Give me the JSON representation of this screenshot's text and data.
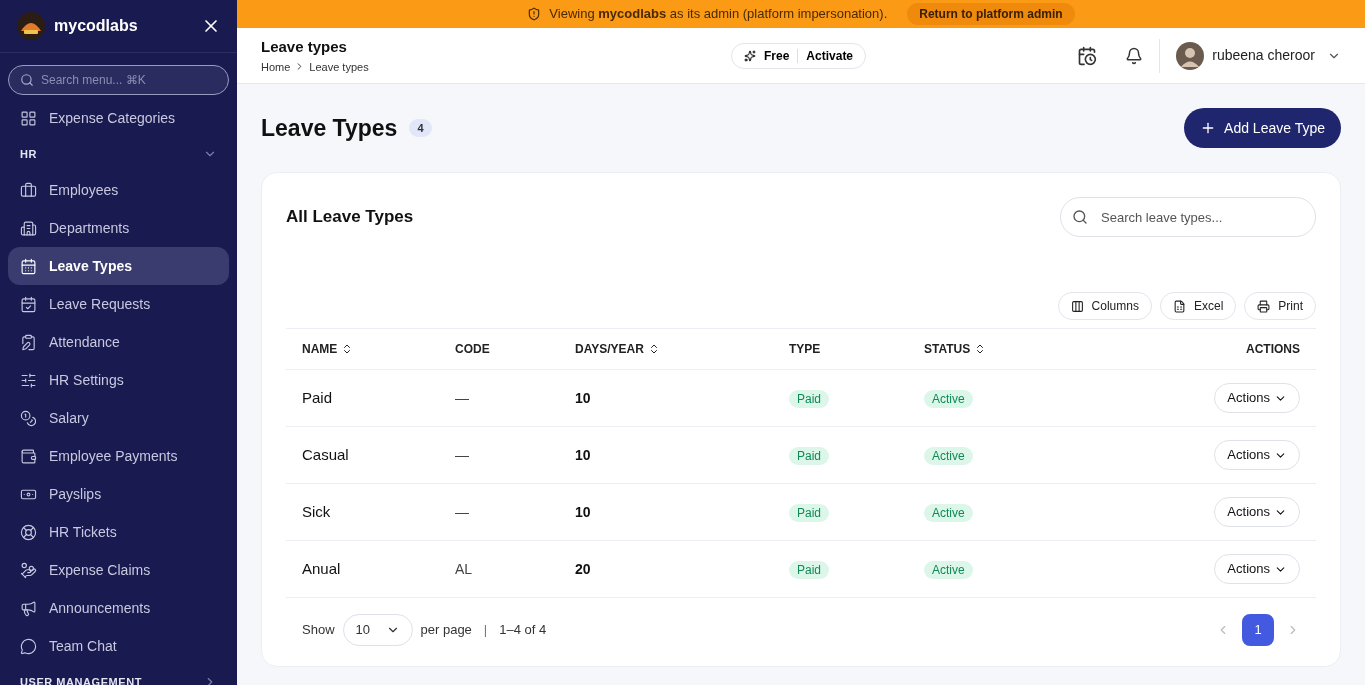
{
  "sidebar": {
    "brand": "mycodlabs",
    "search": {
      "placeholder": "Search menu... ⌘K"
    },
    "items_before": [
      {
        "label": "Expense Categories",
        "selected": false
      }
    ],
    "sections": [
      {
        "title": "HR",
        "expanded": true,
        "items": [
          {
            "label": "Employees",
            "selected": false
          },
          {
            "label": "Departments",
            "selected": false
          },
          {
            "label": "Leave Types",
            "selected": true
          },
          {
            "label": "Leave Requests",
            "selected": false
          },
          {
            "label": "Attendance",
            "selected": false
          },
          {
            "label": "HR Settings",
            "selected": false
          },
          {
            "label": "Salary",
            "selected": false
          },
          {
            "label": "Employee Payments",
            "selected": false
          },
          {
            "label": "Payslips",
            "selected": false
          },
          {
            "label": "HR Tickets",
            "selected": false
          },
          {
            "label": "Expense Claims",
            "selected": false
          },
          {
            "label": "Announcements",
            "selected": false
          },
          {
            "label": "Team Chat",
            "selected": false
          }
        ]
      },
      {
        "title": "USER MANAGEMENT",
        "expanded": false
      }
    ]
  },
  "banner": {
    "text": "Viewing **mycodlabs** as its admin (platform impersonation).",
    "button": "Return to platform admin"
  },
  "header": {
    "title": "Leave types",
    "breadcrumb": [
      "Home",
      "Leave types"
    ],
    "plan": "Free",
    "plan_action": "Activate",
    "user": "rubeena cheroor"
  },
  "page": {
    "title": "Leave Types",
    "count": "4",
    "add_button": "Add Leave Type"
  },
  "table": {
    "title": "All Leave Types",
    "search": {
      "placeholder": "Search leave types..."
    },
    "tools": [
      "Columns",
      "Excel",
      "Print"
    ],
    "columns": [
      {
        "label": "NAME",
        "sortable": true
      },
      {
        "label": "CODE",
        "sortable": false
      },
      {
        "label": "DAYS/YEAR",
        "sortable": true
      },
      {
        "label": "TYPE",
        "sortable": false
      },
      {
        "label": "STATUS",
        "sortable": true
      },
      {
        "label": "ACTIONS",
        "sortable": false
      }
    ],
    "rows": [
      {
        "name": "Paid",
        "code": "—",
        "days": "10",
        "type": "Paid",
        "status": "Active",
        "action": "Actions"
      },
      {
        "name": "Casual",
        "code": "—",
        "days": "10",
        "type": "Paid",
        "status": "Active",
        "action": "Actions"
      },
      {
        "name": "Sick",
        "code": "—",
        "days": "10",
        "type": "Paid",
        "status": "Active",
        "action": "Actions"
      },
      {
        "name": "Anual",
        "code": "AL",
        "days": "20",
        "type": "Paid",
        "status": "Active",
        "action": "Actions"
      }
    ],
    "footer": {
      "show": "Show",
      "page_size": "10",
      "per_page": "per page",
      "separator": "|",
      "range": "1–4 of 4",
      "pages": [
        {
          "label": "1",
          "selected": true
        }
      ]
    }
  }
}
